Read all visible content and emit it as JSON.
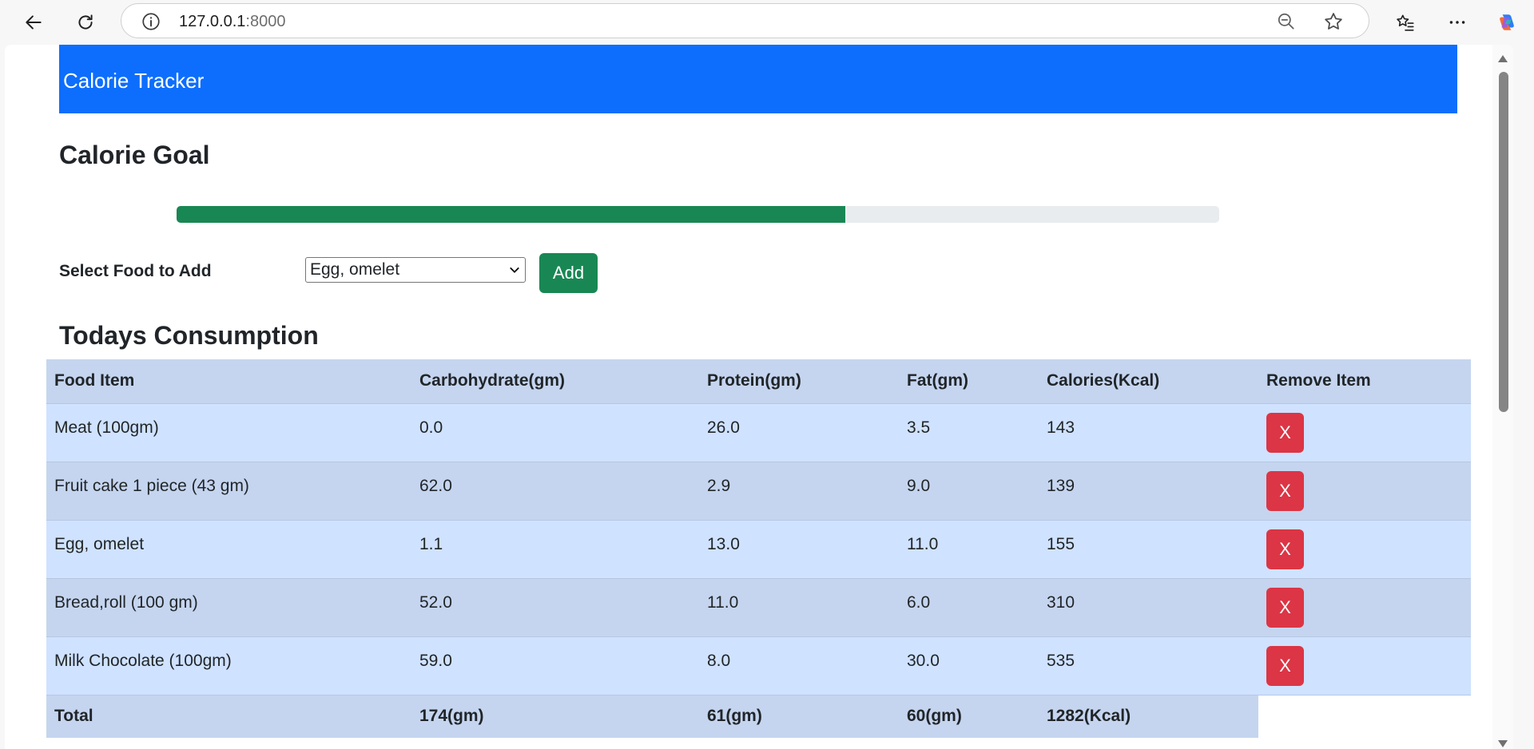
{
  "browser": {
    "url_host": "127.0.0.1",
    "url_port": ":8000"
  },
  "navbar": {
    "brand": "Calorie Tracker"
  },
  "goal": {
    "title": "Calorie Goal",
    "progress_fraction": 0.641
  },
  "add_food": {
    "label": "Select Food to Add",
    "selected": "Egg, omelet",
    "button_label": "Add"
  },
  "consumption": {
    "title": "Todays Consumption",
    "columns": [
      "Food Item",
      "Carbohydrate(gm)",
      "Protein(gm)",
      "Fat(gm)",
      "Calories(Kcal)",
      "Remove Item"
    ],
    "rows": [
      {
        "food": "Meat (100gm)",
        "carbs": "0.0",
        "protein": "26.0",
        "fat": "3.5",
        "calories": "143",
        "remove": "X"
      },
      {
        "food": "Fruit cake 1 piece (43 gm)",
        "carbs": "62.0",
        "protein": "2.9",
        "fat": "9.0",
        "calories": "139",
        "remove": "X"
      },
      {
        "food": "Egg, omelet",
        "carbs": "1.1",
        "protein": "13.0",
        "fat": "11.0",
        "calories": "155",
        "remove": "X"
      },
      {
        "food": "Bread,roll (100 gm)",
        "carbs": "52.0",
        "protein": "11.0",
        "fat": "6.0",
        "calories": "310",
        "remove": "X"
      },
      {
        "food": "Milk Chocolate (100gm)",
        "carbs": "59.0",
        "protein": "8.0",
        "fat": "30.0",
        "calories": "535",
        "remove": "X"
      }
    ],
    "total": {
      "label": "Total",
      "carbs": "174(gm)",
      "protein": "61(gm)",
      "fat": "60(gm)",
      "calories": "1282(Kcal)"
    }
  },
  "colors": {
    "navbar": "#0d6efd",
    "progress": "#198754",
    "add_button": "#198754",
    "remove_button": "#dc3545",
    "row_light": "#cfe2ff",
    "row_dark": "#c5d5ef"
  }
}
